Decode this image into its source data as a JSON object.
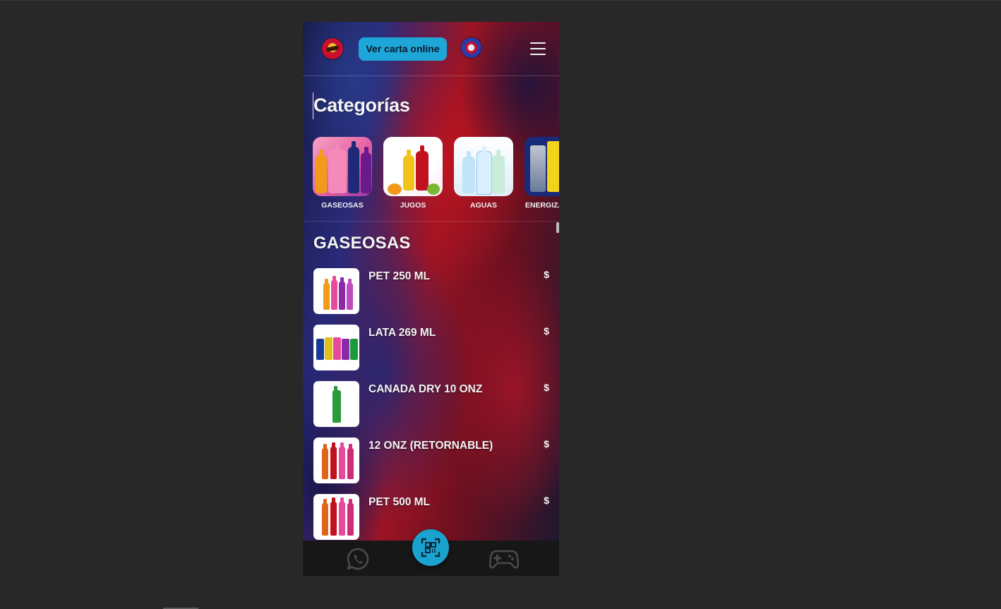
{
  "header": {
    "carta_button": "Ver carta online",
    "left_logo_icon": "brand-logo-icon",
    "right_logo_icon": "partner-logo-icon",
    "menu_icon": "hamburger-menu-icon"
  },
  "categories_title": "Categorías",
  "categories": [
    {
      "label": "GASEOSAS",
      "icon": "soda-bottles-image"
    },
    {
      "label": "JUGOS",
      "icon": "juice-bottles-image"
    },
    {
      "label": "AGUAS",
      "icon": "water-bottles-image"
    },
    {
      "label": "ENERGIZANTES",
      "icon": "energy-cans-image"
    }
  ],
  "section": {
    "title": "GASEOSAS",
    "items": [
      {
        "name": "PET 250 ML",
        "price": "$"
      },
      {
        "name": "LATA 269 ML",
        "price": "$"
      },
      {
        "name": "CANADA DRY 10 ONZ",
        "price": "$"
      },
      {
        "name": "12 ONZ (RETORNABLE)",
        "price": "$"
      },
      {
        "name": "PET 500 ML",
        "price": "$"
      }
    ]
  },
  "bottom_nav": {
    "whatsapp_icon": "whatsapp-icon",
    "qr_icon": "qr-scan-icon",
    "game_icon": "gamepad-icon"
  },
  "colors": {
    "accent": "#1fa6d8",
    "nav_bg": "#171717",
    "page_bg": "#282828"
  }
}
